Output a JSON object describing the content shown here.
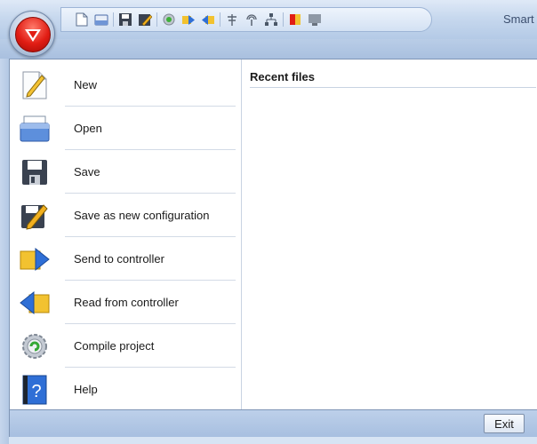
{
  "window": {
    "title": "Smart"
  },
  "app_menu_button": {
    "icon": "logo-icon"
  },
  "quick_access_toolbar": {
    "icons": [
      "new-document-icon",
      "open-icon",
      "save-icon",
      "save-as-icon",
      "compile-icon",
      "send-icon",
      "read-icon",
      "antenna-icon",
      "wireless-icon",
      "network-icon",
      "color-icon",
      "monitor-icon"
    ]
  },
  "menu": {
    "items": [
      {
        "label": "New",
        "icon": "new-document-icon"
      },
      {
        "label": "Open",
        "icon": "open-icon"
      },
      {
        "label": "Save",
        "icon": "save-icon"
      },
      {
        "label": "Save as new configuration",
        "icon": "save-as-icon"
      },
      {
        "label": "Send to controller",
        "icon": "send-to-controller-icon"
      },
      {
        "label": "Read from controller",
        "icon": "read-from-controller-icon"
      },
      {
        "label": "Compile project",
        "icon": "compile-icon"
      },
      {
        "label": "Help",
        "icon": "help-icon"
      }
    ]
  },
  "recent_files": {
    "heading": "Recent files"
  },
  "footer": {
    "exit_label": "Exit"
  },
  "colors": {
    "accent_red": "#e11d14",
    "ribbon_blue": "#c7d8ee"
  }
}
